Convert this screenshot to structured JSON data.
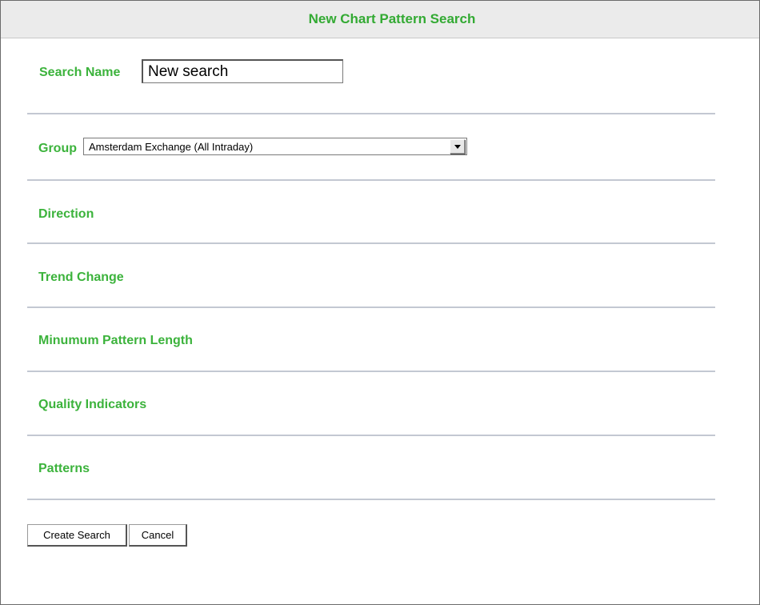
{
  "window": {
    "title": "New Chart Pattern Search"
  },
  "search_name": {
    "label": "Search Name",
    "value": "New search"
  },
  "group": {
    "label": "Group",
    "selected": "Amsterdam Exchange (All Intraday)"
  },
  "sections": {
    "direction": "Direction",
    "trend_change": "Trend Change",
    "min_pattern_length": "Minumum Pattern Length",
    "quality_indicators": "Quality Indicators",
    "patterns": "Patterns"
  },
  "buttons": {
    "create": "Create Search",
    "cancel": "Cancel"
  },
  "colors": {
    "accent_green": "#3cb33c",
    "title_bar": "#ebebeb",
    "divider": "#c3c8d2"
  },
  "icons": {
    "dropdown": "chevron-down-icon"
  }
}
